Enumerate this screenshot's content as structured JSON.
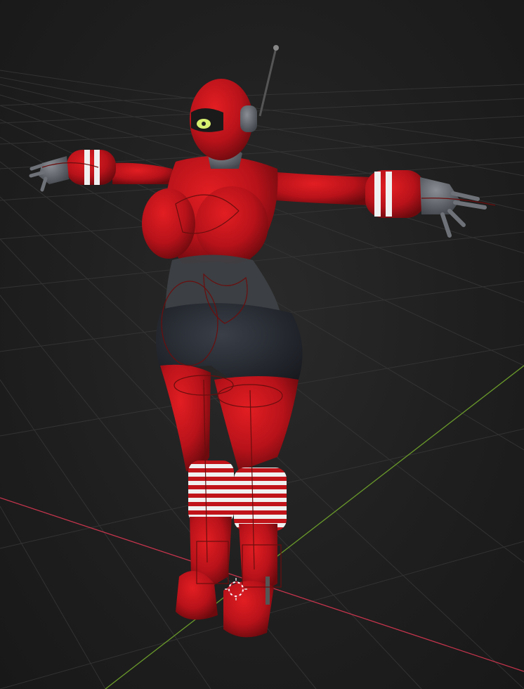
{
  "viewport": {
    "mode": "3d-viewport",
    "background_color": "#1d1d1d",
    "grid_color": "#3a3a3a",
    "x_axis_color": "#c4344c",
    "y_axis_color": "#6a9a2a"
  },
  "model": {
    "pose": "T-pose",
    "primary_color": "#c0141a",
    "secondary_color": "#6e7278",
    "dark_color": "#22252c",
    "stripe_color": "#f2f2f2",
    "eye_color": "#d8f070",
    "rig_wire_color": "#6a0e0e",
    "icon": "character-model-icon"
  },
  "cursor": {
    "icon": "3d-cursor-icon"
  }
}
